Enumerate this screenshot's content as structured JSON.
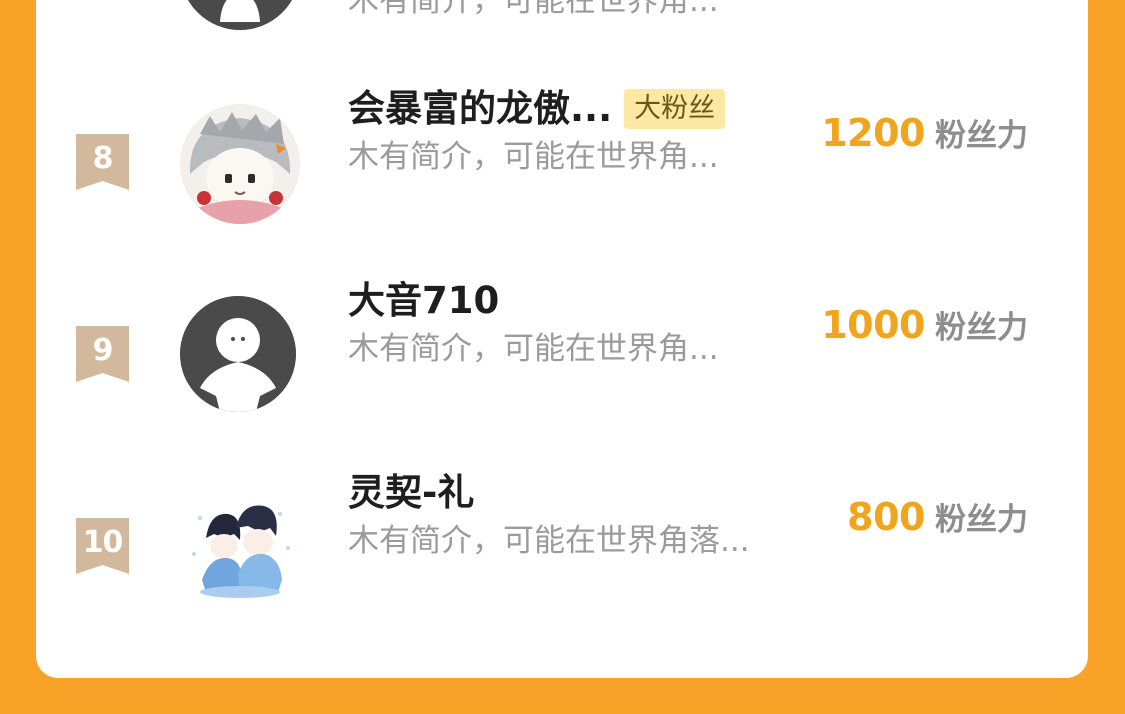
{
  "colors": {
    "page_background": "#f8a227",
    "card": "#ffffff",
    "rank_tag": "#d2b89c",
    "score": "#f2a41d",
    "badge_background": "#fbe9a3"
  },
  "ranking": [
    {
      "name": "",
      "badge": "",
      "bio": "木有简介，可能在世界角...",
      "score": "",
      "unit": "",
      "avatar": "default-silhouette-icon"
    },
    {
      "rank": "8",
      "name": "会暴富的龙傲...",
      "badge": "大粉丝",
      "bio": "木有简介，可能在世界角...",
      "score": "1200",
      "unit": "粉丝力",
      "avatar": "anime-girl-avatar"
    },
    {
      "rank": "9",
      "name": "大音710",
      "bio": "木有简介，可能在世界角...",
      "score": "1000",
      "unit": "粉丝力",
      "avatar": "default-silhouette-icon"
    },
    {
      "rank": "10",
      "name": "灵契-礼",
      "bio": "木有简介，可能在世界角落...",
      "score": "800",
      "unit": "粉丝力",
      "avatar": "anime-couple-avatar"
    }
  ]
}
